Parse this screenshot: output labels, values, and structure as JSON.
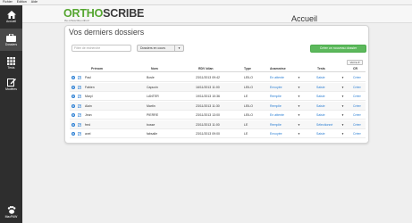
{
  "menubar": [
    "Fichier",
    "Edition",
    "Aide"
  ],
  "nav": {
    "accueil": "Accueil",
    "dossiers": "Dossiers",
    "tests": "Tests",
    "modeles": "Modèles",
    "bottom": "MacPAW"
  },
  "header": {
    "logo_a": "ORTHO",
    "logo_b": "SCRIBE",
    "tagline": "the orthoscribe.ortho.fr",
    "title": "Accueil"
  },
  "card": {
    "title": "Vos derniers dossiers",
    "search_placeholder": "Filtre de recherche",
    "filter_label": "Dossiers en cours",
    "new_button": "Créer un nouveau dossier",
    "small_button": "Voir le"
  },
  "columns": [
    "Prénom",
    "Nom",
    "RDV bilan",
    "Type",
    "Anamnèse",
    "Tests",
    "CR"
  ],
  "rows": [
    {
      "prenom": "Paul",
      "nom": "Bosle",
      "rdv": "23/11/2013 09:42",
      "type": "LEILO",
      "anamnese": "En attente",
      "tests": "Saisie",
      "cr": "Créer"
    },
    {
      "prenom": "Fabien",
      "nom": "Capucin",
      "rdv": "16/11/2013 11:00",
      "type": "LEILO",
      "anamnese": "Envoyée",
      "tests": "Saisie",
      "cr": "Créer"
    },
    {
      "prenom": "Maryl",
      "nom": "LANTER",
      "rdv": "19/11/2013 10:36",
      "type": "LE",
      "anamnese": "Remplie",
      "tests": "Saisie",
      "cr": "Créer"
    },
    {
      "prenom": "Alain",
      "nom": "Martin",
      "rdv": "23/11/2013 11:30",
      "type": "LEILO",
      "anamnese": "Remplie",
      "tests": "Saisie",
      "cr": "Créer"
    },
    {
      "prenom": "Jean",
      "nom": "PIERRE",
      "rdv": "23/11/2013 13:00",
      "type": "LEILO",
      "anamnese": "En attente",
      "tests": "Saisie",
      "cr": "Créer"
    },
    {
      "prenom": "fred",
      "nom": "bosse",
      "rdv": "23/11/2013 11:00",
      "type": "LE",
      "anamnese": "Remplie",
      "tests": "Sélectionné",
      "cr": "Créer"
    },
    {
      "prenom": "axel",
      "nom": "fabsalle",
      "rdv": "23/11/2013 09:00",
      "type": "LE",
      "anamnese": "Envoyée",
      "tests": "Saisie",
      "cr": "Créer"
    }
  ],
  "colors": {
    "logo_green": "#55a630",
    "button_green": "#5cb85c",
    "link_blue": "#2a7ed3",
    "nav_dark": "#2e2e2e"
  }
}
